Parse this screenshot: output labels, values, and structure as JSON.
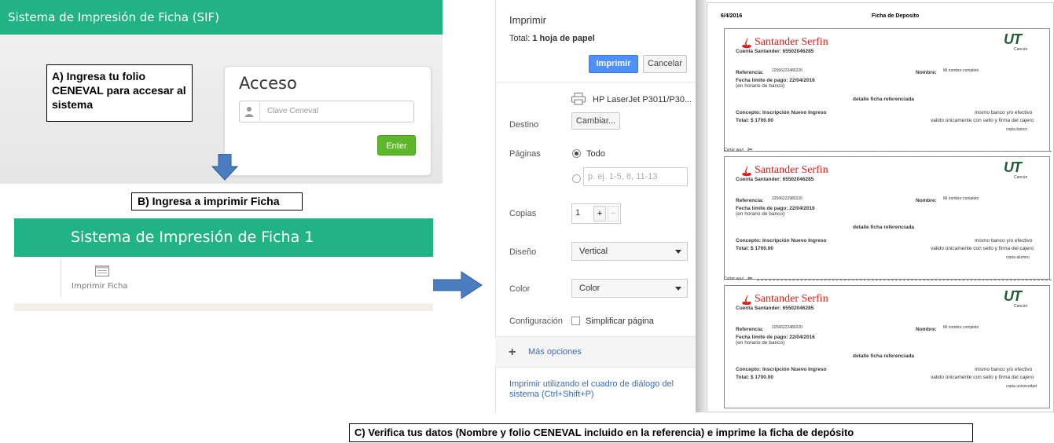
{
  "panel_a": {
    "header_title": "Sistema de Impresión de Ficha (SIF)",
    "note": "A) Ingresa tu folio CENEVAL para accesar al sistema",
    "login_title": "Acceso",
    "input_placeholder": "Clave Ceneval",
    "enter_label": "Enter"
  },
  "panel_b": {
    "note": "B)  Ingresa a imprimir Ficha",
    "header_title": "Sistema de Impresión de Ficha 1",
    "menu_label": "Imprimir Ficha"
  },
  "print_dialog": {
    "title": "Imprimir",
    "total_prefix": "Total:",
    "total_value": "1 hoja de papel",
    "print_button": "Imprimir",
    "cancel_button": "Cancelar",
    "destination_label": "Destino",
    "printer_name": "HP LaserJet P3011/P30...",
    "change_button": "Cambiar...",
    "pages_label": "Páginas",
    "pages_all": "Todo",
    "pages_placeholder": "p. ej. 1-5, 8, 11-13",
    "copies_label": "Copias",
    "copies_value": "1",
    "copies_plus": "+",
    "copies_minus": "−",
    "layout_label": "Diseño",
    "layout_value": "Vertical",
    "color_label": "Color",
    "color_value": "Color",
    "config_label": "Configuración",
    "simplify_label": "Simplificar página",
    "more_options": "Más opciones",
    "system_dialog_link": "Imprimir utilizando el cuadro de diálogo del sistema (Ctrl+Shift+P)"
  },
  "preview": {
    "date": "6/4/2016",
    "title": "Ficha de Deposito",
    "cut_label": "Cortar aquí",
    "slips": [
      {
        "bank": "Santander Serfin",
        "account": "Cuenta  Santander: 65502046285",
        "logo": "UT",
        "campus": "Cancún",
        "ref_label": "Referencia:",
        "ref_value": "22566222480220",
        "name_label": "Nombre:",
        "name_value": "Mi nombre completo",
        "deadline": "Fecha límite de pago: 22/04/2016",
        "deadline_note": "(en horario de banco)",
        "detail": "detalle ficha referenciada",
        "concept": "Concepto: Inscripción Nuevo Ingreso",
        "bank_note": "mismo banco y/o efectivo",
        "total": "Total:  $ 1700.00",
        "validity": "valido únicamente con sello y firma del cajero",
        "copy": "copia banco"
      },
      {
        "bank": "Santander Serfin",
        "account": "Cuenta  Santander: 65502046285",
        "logo": "UT",
        "campus": "Cancún",
        "ref_label": "Referencia:",
        "ref_value": "22566222980220",
        "name_label": "Nombre:",
        "name_value": "Mi nombre completo",
        "deadline": "Fecha límite de pago: 22/04/2016",
        "deadline_note": "(en horario de banco)",
        "detail": "detalle ficha referenciada",
        "concept": "Concepto: Inscripción Nuevo Ingreso",
        "bank_note": "mismo banco y/o efectivo",
        "total": "Total:  $ 1700.00",
        "validity": "valido únicamente con sello y firma del cajero",
        "copy": "copia alumno"
      },
      {
        "bank": "Santander Serfin",
        "account": "Cuenta  Santander: 65502046285",
        "logo": "UT",
        "campus": "Cancún",
        "ref_label": "Referencia:",
        "ref_value": "22566222480220",
        "name_label": "Nombre:",
        "name_value": "Mi nombre completo",
        "deadline": "Fecha límite de pago: 22/04/2016",
        "deadline_note": "(en horario de banco)",
        "detail": "detalle ficha referenciada",
        "concept": "Concepto: Inscripción Nuevo Ingreso",
        "bank_note": "mismo banco y/o efectivo",
        "total": "Total:  $ 1700.00",
        "validity": "valido únicamente con sello y firma del cajero",
        "copy": "copia universidad"
      }
    ]
  },
  "note_c": "C) Verifica tus datos (Nombre y folio CENEVAL incluido en la referencia) e imprime la ficha de depósito",
  "colors": {
    "header_green": "#21b383",
    "enter_green": "#5cb82a",
    "print_blue": "#4d90fe",
    "arrow_blue": "#4a7dc0",
    "santander_red": "#d9211c"
  }
}
